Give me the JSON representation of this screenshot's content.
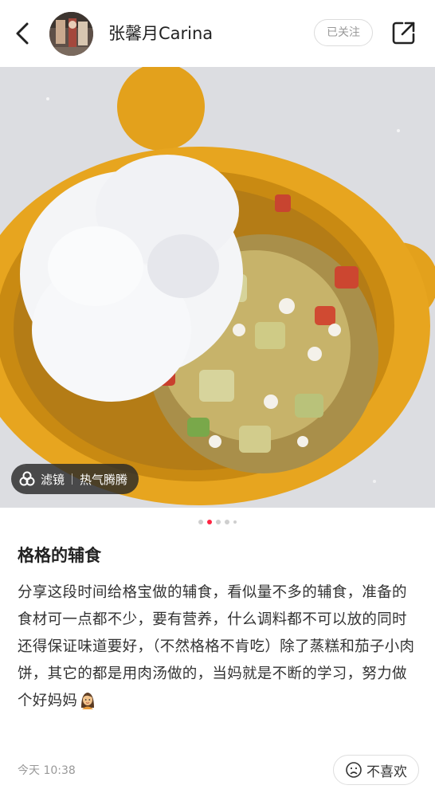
{
  "header": {
    "author_name": "张馨月Carina",
    "follow_label": "已关注"
  },
  "filter": {
    "label": "滤镜",
    "name": "热气腾腾"
  },
  "carousel": {
    "count": 5,
    "active_index": 1
  },
  "post": {
    "title": "格格的辅食",
    "body": "分享这段时间给格宝做的辅食，看似量不多的辅食，准备的食材可一点都不少，要有营养，什么调料都不可以放的同时还得保证味道要好，（不然格格不肯吃）除了蒸糕和茄子小肉饼，其它的都是用肉汤做的，当妈就是不断的学习，努力做个好妈妈",
    "emoji": "woman-emoji",
    "time": "今天 10:38"
  },
  "actions": {
    "dislike_label": "不喜欢"
  },
  "colors": {
    "accent": "#ff2442",
    "bowl": "#e6a21c"
  }
}
